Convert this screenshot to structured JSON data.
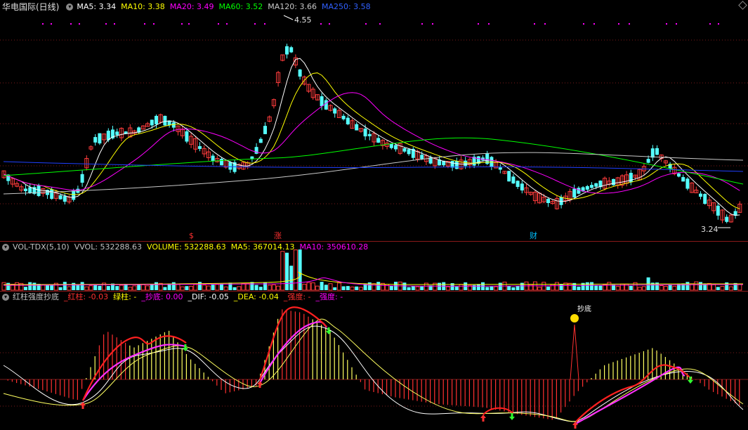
{
  "main": {
    "title": "华电国际(日线)",
    "ma": [
      {
        "label": "MA5: 3.34",
        "color": "#ffffff"
      },
      {
        "label": "MA10: 3.38",
        "color": "#ffff00"
      },
      {
        "label": "MA20: 3.49",
        "color": "#ff00ff"
      },
      {
        "label": "MA60: 3.52",
        "color": "#00ff00"
      },
      {
        "label": "MA120: 3.66",
        "color": "#c8c8c8"
      },
      {
        "label": "MA250: 3.58",
        "color": "#0000ff"
      }
    ],
    "high_label": "4.55",
    "low_label": "3.24",
    "markers": [
      {
        "text": "$",
        "color": "#ff3030"
      },
      {
        "text": "涨",
        "color": "#ff3030"
      },
      {
        "text": "财",
        "color": "#00c0ff"
      }
    ]
  },
  "volume": {
    "title": "VOL-TDX(5,10)",
    "items": [
      {
        "label": "VVOL: 532288.63",
        "color": "#c0c0c0"
      },
      {
        "label": "VOLUME: 532288.63",
        "color": "#ffff00"
      },
      {
        "label": "MA5: 367014.13",
        "color": "#ffff00"
      },
      {
        "label": "MA10: 350610.28",
        "color": "#ff00ff"
      }
    ]
  },
  "indicator": {
    "title": "红柱强度抄底",
    "items": [
      {
        "label": "_红柱: -0.03",
        "color": "#ff3030"
      },
      {
        "label": "绿柱: -",
        "color": "#ffff00"
      },
      {
        "label": "_抄底: 0.00",
        "color": "#ff00ff"
      },
      {
        "label": "_DIF: -0.05",
        "color": "#ffffff"
      },
      {
        "label": "_DEA: -0.04",
        "color": "#ffff00"
      },
      {
        "label": "_强度: -",
        "color": "#ff3030"
      },
      {
        "label": "_强度: -",
        "color": "#ff00ff"
      }
    ],
    "signal_label": "抄底"
  },
  "colors": {
    "up": "#ff3c3c",
    "down": "#55ffff",
    "grid": "#8b1a1a"
  }
}
